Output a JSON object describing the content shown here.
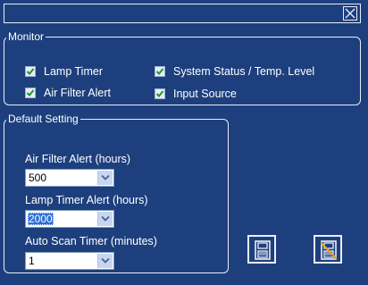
{
  "dialog": {
    "close_icon": "close-x-icon"
  },
  "monitor": {
    "legend": "Monitor",
    "items": [
      {
        "label": "Lamp Timer",
        "checked": true
      },
      {
        "label": "Air Filter Alert",
        "checked": true
      },
      {
        "label": "System Status / Temp. Level",
        "checked": true
      },
      {
        "label": "Input Source",
        "checked": true
      }
    ]
  },
  "default_setting": {
    "legend": "Default Setting",
    "air_filter_alert": {
      "label": "Air Filter Alert (hours)",
      "value": "500"
    },
    "lamp_timer_alert": {
      "label": "Lamp Timer Alert (hours)",
      "value": "2000"
    },
    "auto_scan_timer": {
      "label": "Auto Scan Timer (minutes)",
      "value": "1"
    }
  },
  "actions": {
    "save_icon": "save-disk-icon",
    "no_save_icon": "save-disabled-icon"
  },
  "colors": {
    "background": "#1d3f7d",
    "border": "#e9eef8",
    "check": "#1e9a2c",
    "selection": "#2e6ed6",
    "no_save_slash": "#e8a21a"
  }
}
